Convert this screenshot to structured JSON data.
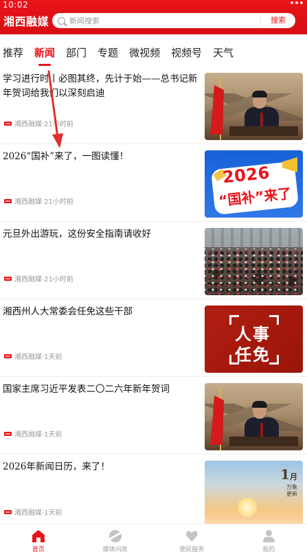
{
  "status_bar": {
    "time": "10:02"
  },
  "header": {
    "brand": "湘西融媒",
    "search_placeholder": "新闻搜索",
    "search_button": "搜索"
  },
  "tabs": [
    {
      "label": "推荐",
      "active": false
    },
    {
      "label": "新闻",
      "active": true
    },
    {
      "label": "部门",
      "active": false
    },
    {
      "label": "专题",
      "active": false
    },
    {
      "label": "微视频",
      "active": false
    },
    {
      "label": "视频号",
      "active": false
    },
    {
      "label": "天气",
      "active": false
    }
  ],
  "news": [
    {
      "title": "学习进行时丨必图其终，先计于始——总书记新年贺词给我们以深刻启迪",
      "source": "湘西融媒",
      "time": "·21小时前",
      "image": "president-flag-greatwall"
    },
    {
      "title": "2026“国补”来了，一图读懂！",
      "source": "湘西融媒",
      "time": "·21小时前",
      "image": "guobu-banner",
      "image_text_1": "2026",
      "image_text_2": "“国补”来了"
    },
    {
      "title": "元旦外出游玩，这份安全指南请收好",
      "source": "湘西融媒",
      "time": "·21小时前",
      "image": "crowd-street"
    },
    {
      "title": "湘西州人大常委会任免这些干部",
      "source": "湘西融媒",
      "time": "·1天前",
      "image": "renshi-renmian",
      "image_text_1": "人事",
      "image_text_2": "任免"
    },
    {
      "title": "国家主席习近平发表二〇二六年新年贺词",
      "source": "湘西融媒",
      "time": "·1天前",
      "image": "president-flag-greatwall"
    },
    {
      "title": "2026年新闻日历，来了！",
      "source": "湘西融媒",
      "time": "·1天前",
      "image": "sunrise-calendar",
      "image_text_1": "1",
      "image_text_2": "月",
      "image_text_3": "万象",
      "image_text_4": "更新"
    }
  ],
  "bottom_nav": [
    {
      "label": "首页",
      "icon": "home-icon",
      "active": true
    },
    {
      "label": "媒体问政",
      "icon": "media-icon",
      "active": false
    },
    {
      "label": "便民服务",
      "icon": "heart-icon",
      "active": false
    },
    {
      "label": "我的",
      "icon": "user-icon",
      "active": false
    }
  ],
  "colors": {
    "brand_red": "#e8141a",
    "annotation_red": "#e03030"
  }
}
